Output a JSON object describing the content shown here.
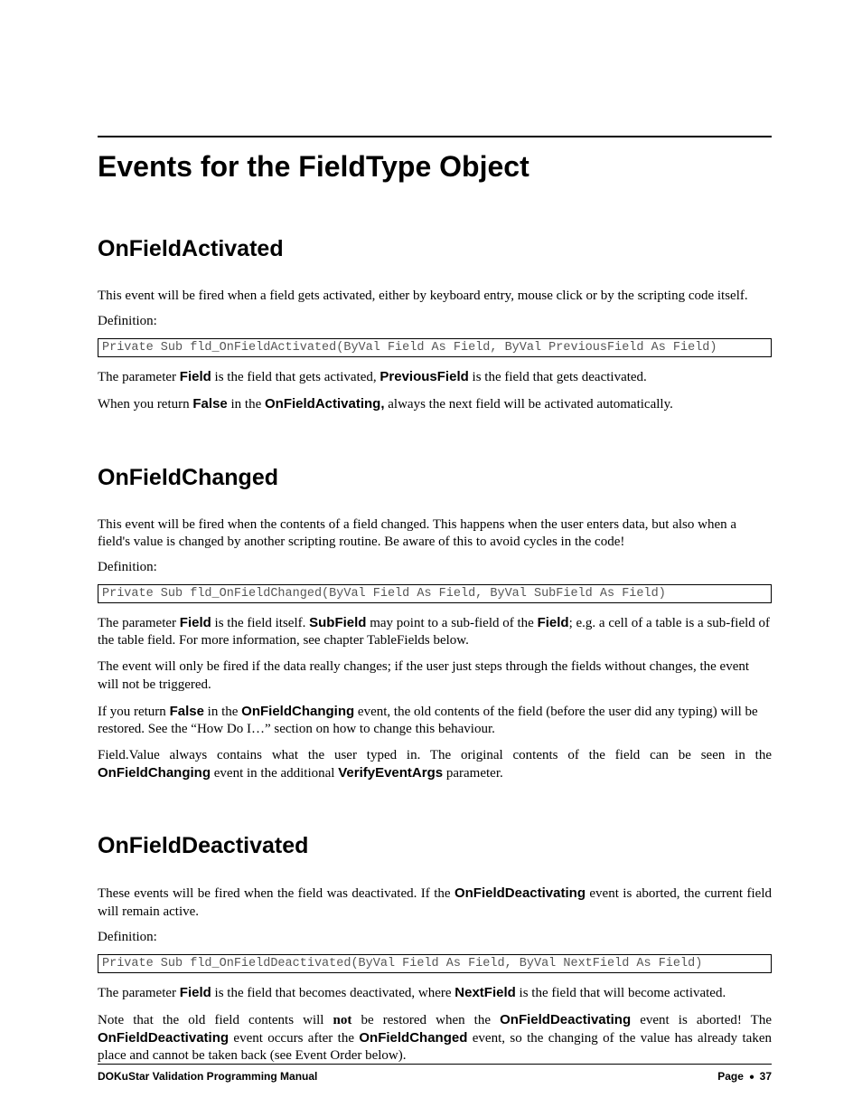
{
  "title": "Events for the FieldType Object",
  "s1": {
    "heading": "OnFieldActivated",
    "p1": "This event will be fired when a field gets activated, either by keyboard entry, mouse click or by the scripting code itself.",
    "def_label": "Definition:",
    "code": "Private Sub fld_OnFieldActivated(ByVal Field As Field, ByVal PreviousField As Field)",
    "p2_a": "The parameter ",
    "p2_b": "Field",
    "p2_c": " is the field that gets activated, ",
    "p2_d": "PreviousField",
    "p2_e": " is the field that gets deactivated.",
    "p3_a": "When you return ",
    "p3_b": "False",
    "p3_c": " in the ",
    "p3_d": "OnFieldActivating,",
    "p3_e": " always the next field will be activated automatically."
  },
  "s2": {
    "heading": "OnFieldChanged",
    "p1": "This event will be fired when the contents of a field changed. This happens when the user enters data, but also when a field's value is changed by another scripting routine. Be aware of this to avoid cycles in the code!",
    "def_label": "Definition:",
    "code": "Private Sub fld_OnFieldChanged(ByVal Field As Field, ByVal SubField As Field)",
    "p2_a": "The parameter ",
    "p2_b": "Field",
    "p2_c": " is the field itself. ",
    "p2_d": "SubField",
    "p2_e": " may point to a sub-field of the ",
    "p2_f": "Field",
    "p2_g": "; e.g. a cell of a table is a sub-field of the table field. For more information, see chapter TableFields below.",
    "p3": "The event will only be fired if the data really changes; if the user just steps through the fields without changes, the event will not be triggered.",
    "p4_a": "If you return ",
    "p4_b": "False",
    "p4_c": " in the ",
    "p4_d": "OnFieldChanging",
    "p4_e": " event, the old contents of the field (before the user did any typing) will be restored. See the “How Do I…” section on how to change this behaviour.",
    "p5_a": "Field.Value always contains what the user typed in. The original contents of the field can be seen in the ",
    "p5_b": "OnFieldChanging",
    "p5_c": " event in the additional ",
    "p5_d": "VerifyEventArgs",
    "p5_e": " parameter."
  },
  "s3": {
    "heading": "OnFieldDeactivated",
    "p1_a": "These events will be fired when the field was deactivated. If the ",
    "p1_b": "OnFieldDeactivating",
    "p1_c": " event is aborted, the current field will remain active.",
    "def_label": "Definition:",
    "code": "Private Sub fld_OnFieldDeactivated(ByVal Field As Field, ByVal NextField As Field)",
    "p2_a": "The parameter ",
    "p2_b": "Field",
    "p2_c": " is the field that becomes deactivated, where ",
    "p2_d": "NextField",
    "p2_e": " is the field that will become activated.",
    "p3_a": "Note that the old field contents will ",
    "p3_b": "not",
    "p3_c": " be restored when the ",
    "p3_d": "OnFieldDeactivating",
    "p3_e": " event is aborted! The ",
    "p3_f": "OnFieldDeactivating",
    "p3_g": " event occurs after the ",
    "p3_h": "OnFieldChanged",
    "p3_i": " event, so the changing of the value has already taken place and cannot be taken back (see Event Order below)."
  },
  "footer": {
    "left": "DOKuStar Validation Programming Manual",
    "right_a": "Page",
    "right_b": "37"
  }
}
